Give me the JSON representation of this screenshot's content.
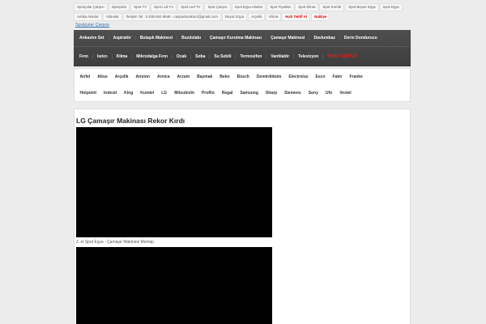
{
  "top_links": [
    {
      "label": "Spotçular Çarşısı"
    },
    {
      "label": "Spotçular"
    },
    {
      "label": "Spot TV"
    },
    {
      "label": "Spot Lcd TV"
    },
    {
      "label": "Spot Led TV"
    },
    {
      "label": "Spot Çarşısı"
    },
    {
      "label": "Spot Eşya Alanlar"
    },
    {
      "label": "Spot Fiyatları"
    },
    {
      "label": "Spot Klima"
    },
    {
      "label": "Spot Kombi"
    },
    {
      "label": "Spot Beyaz Eşya"
    },
    {
      "label": "Spot Eşya"
    },
    {
      "label": "Antika Alanlar"
    },
    {
      "label": "Videolar"
    },
    {
      "label": "İletişim Tel : 0 538 662 8948 - caspaducakinci@gmail.com"
    },
    {
      "label": "Beyaz Eşya"
    },
    {
      "label": "Arçelik"
    },
    {
      "label": "Klima"
    },
    {
      "label": "Hızlı Teklif Al",
      "hot": true
    },
    {
      "label": "Nakliye",
      "hot": true
    }
  ],
  "site_link": "Spotçular Çarşısı",
  "category_nav": {
    "row1": [
      "Ankastre Set",
      "Aspiratör",
      "Bulaşık Makinesi",
      "Buzdolabı",
      "Çamaşır Kurutma Makinası",
      "Çamaşır Makinesi",
      "Davlumbaz",
      "Derin Dondurucu"
    ],
    "row2": [
      "Fırın",
      "Isıtıcı",
      "Klima",
      "Mikrodalga Fırın",
      "Ocak",
      "Soba",
      "Su Sebili",
      "Termosifon",
      "Vantilatör",
      "Televizyon"
    ],
    "highlight": "Hızlı Teklif Al"
  },
  "brand_nav": {
    "row1": [
      "Airfel",
      "Altus",
      "Arçelik",
      "Ariston",
      "Arnica",
      "Arzum",
      "Baymak",
      "Beko",
      "Bosch",
      "Demirdöküm",
      "Electrolux",
      "Esco",
      "Fakir",
      "Franke"
    ],
    "row2": [
      "Hotpoint",
      "Indesit",
      "King",
      "Kumtel",
      "LG",
      "Mitsubishi",
      "Profilo",
      "Regal",
      "Samsung",
      "Sharp",
      "Siemens",
      "Sony",
      "Ufo",
      "Vestel"
    ]
  },
  "article": {
    "title": "LG Çamaşır Makinası Rekor Kırdı",
    "video_caption": "2. el Spot Eşya - Çamaşır Makinesi Montajı"
  }
}
